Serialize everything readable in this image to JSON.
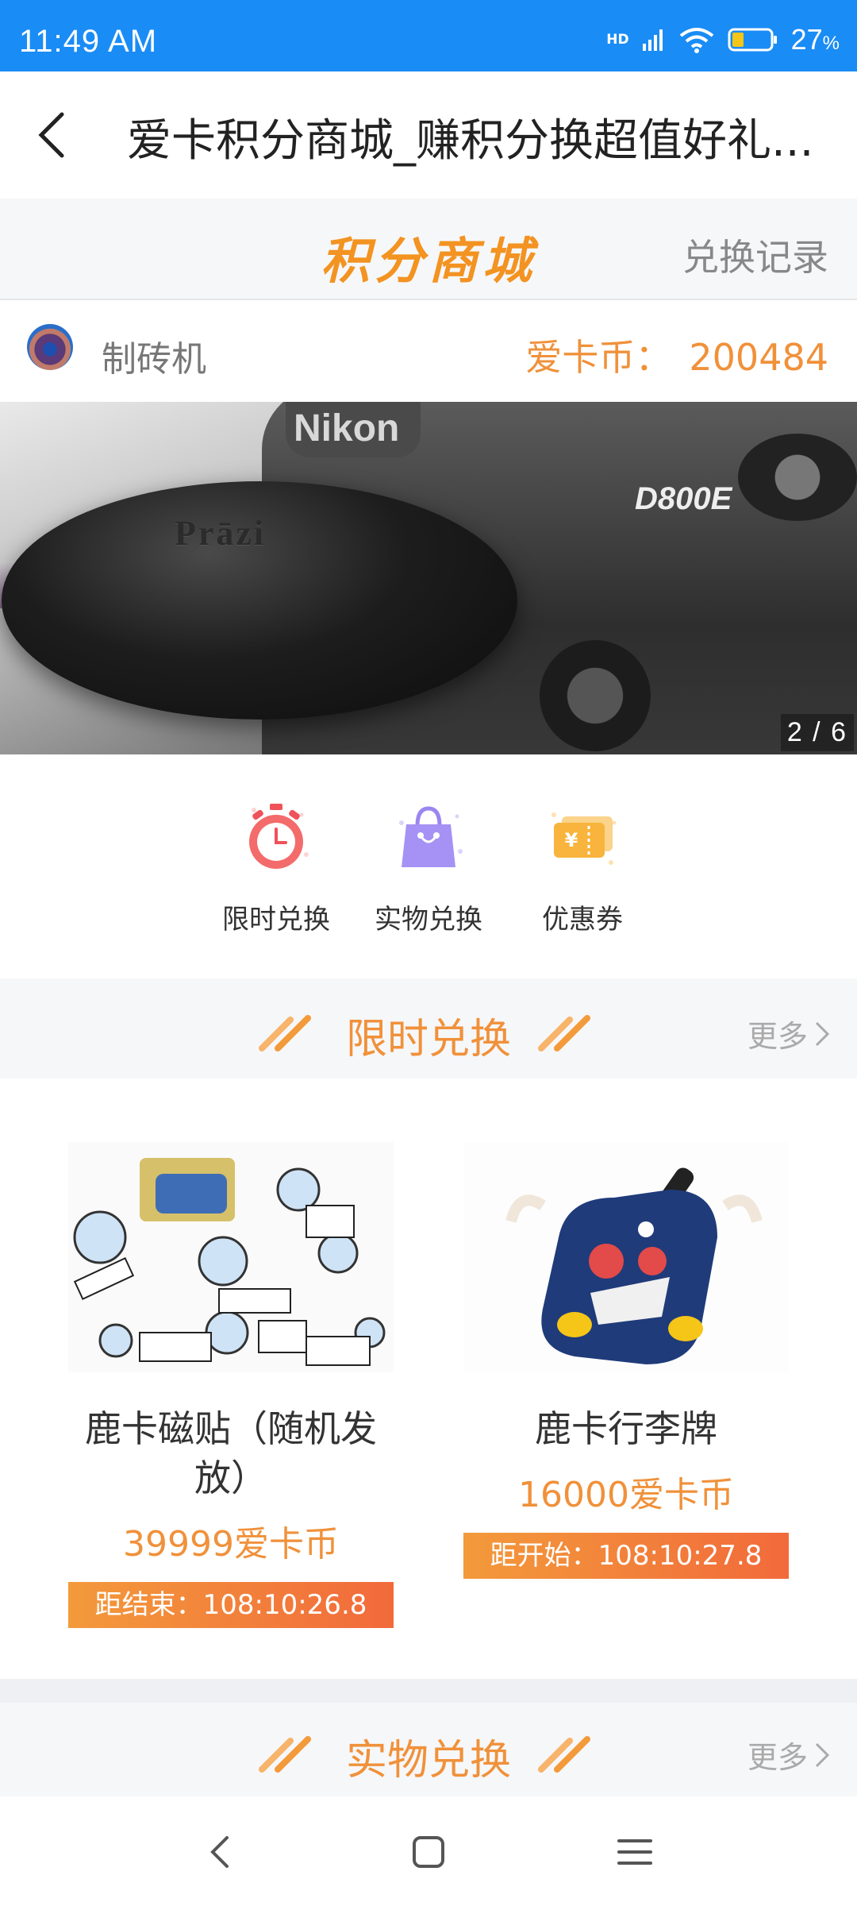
{
  "status_bar": {
    "time": "11:49 AM",
    "network": "HD",
    "battery": "27",
    "battery_unit": "%"
  },
  "titlebar": {
    "title": "爱卡积分商城_赚积分换超值好礼..."
  },
  "mall_header": {
    "logo": "积分商城",
    "record_link": "兑换记录"
  },
  "user": {
    "name": "制砖机",
    "coin_label": "爱卡币：",
    "coin_value": "200484"
  },
  "banner": {
    "brand_text": "Prāzi",
    "camera_brand": "Nikon",
    "camera_model": "D800E",
    "indicator": "2 / 6"
  },
  "quick_entries": [
    {
      "label": "限时兑换",
      "icon": "stopwatch-icon"
    },
    {
      "label": "实物兑换",
      "icon": "shopping-bag-icon"
    },
    {
      "label": "优惠券",
      "icon": "coupon-icon"
    }
  ],
  "section_limited": {
    "title": "限时兑换",
    "more": "更多"
  },
  "products": [
    {
      "name": "鹿卡磁贴（随机发放）",
      "price": "39999爱卡币",
      "timer": "距结束：108:10:26.8"
    },
    {
      "name": "鹿卡行李牌",
      "price": "16000爱卡币",
      "timer": "距开始：108:10:27.8"
    }
  ],
  "section_physical": {
    "title": "实物兑换",
    "more": "更多"
  },
  "colors": {
    "status_bar": "#1a8cf5",
    "accent": "#f0913a",
    "timer_bg": "#f26a3b"
  }
}
